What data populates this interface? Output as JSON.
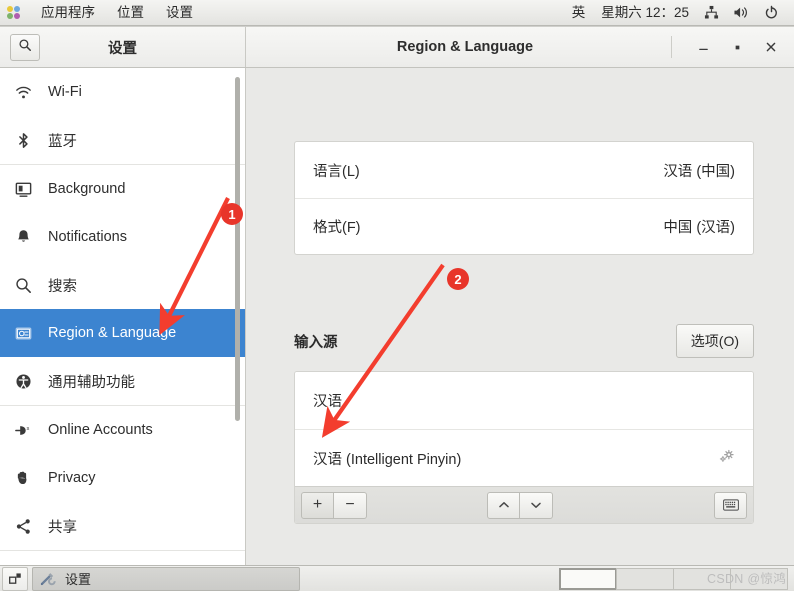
{
  "top_panel": {
    "logo": "gnome-foot-icon",
    "menus": [
      "应用程序",
      "位置",
      "设置"
    ],
    "input_method": "英",
    "clock": "星期六  12：25",
    "tray": [
      "network-icon",
      "volume-icon",
      "power-icon"
    ]
  },
  "window": {
    "sidebar_title": "设置",
    "title": "Region & Language",
    "search_icon": "search-icon",
    "controls": {
      "minimize": "–",
      "maximize": "▫",
      "close": "✕"
    }
  },
  "sidebar": {
    "groups": [
      {
        "items": [
          {
            "label": "Wi-Fi",
            "icon": "wifi-icon",
            "selected": false
          },
          {
            "label": "蓝牙",
            "icon": "bluetooth-icon",
            "selected": false
          }
        ]
      },
      {
        "items": [
          {
            "label": "Background",
            "icon": "background-icon",
            "selected": false
          },
          {
            "label": "Notifications",
            "icon": "bell-icon",
            "selected": false
          },
          {
            "label": "搜索",
            "icon": "search-icon",
            "selected": false
          },
          {
            "label": "Region & Language",
            "icon": "region-language-icon",
            "selected": true
          },
          {
            "label": "通用辅助功能",
            "icon": "accessibility-icon",
            "selected": false
          }
        ]
      },
      {
        "items": [
          {
            "label": "Online Accounts",
            "icon": "online-accounts-icon",
            "selected": false
          },
          {
            "label": "Privacy",
            "icon": "privacy-hand-icon",
            "selected": false
          },
          {
            "label": "共享",
            "icon": "share-icon",
            "selected": false
          }
        ]
      }
    ]
  },
  "main": {
    "language_rows": [
      {
        "label": "语言(L)",
        "value": "汉语 (中国)"
      },
      {
        "label": "格式(F)",
        "value": "中国 (汉语)"
      }
    ],
    "input_sources": {
      "title": "输入源",
      "options_button": "选项(O)",
      "rows": [
        {
          "label": "汉语",
          "gear": false
        },
        {
          "label": "汉语 (Intelligent Pinyin)",
          "gear": true
        }
      ],
      "toolbar": {
        "add": "+",
        "remove": "−",
        "move_up": "⌃",
        "move_down": "⌄",
        "keyboard": "keyboard-icon"
      }
    }
  },
  "annotations": [
    {
      "id": "1",
      "number": "1"
    },
    {
      "id": "2",
      "number": "2"
    }
  ],
  "taskbar": {
    "show_desktop": "show-desktop-icon",
    "task": {
      "label": "设置",
      "icon": "settings-tools-icon"
    },
    "workspaces": 4,
    "active_workspace": 1,
    "watermark": "CSDN @惊鸿"
  },
  "colors": {
    "accent": "#3c84d0",
    "annotation": "#e8352a",
    "panel_bg": "#ececea",
    "main_bg": "#e9e9e7"
  }
}
